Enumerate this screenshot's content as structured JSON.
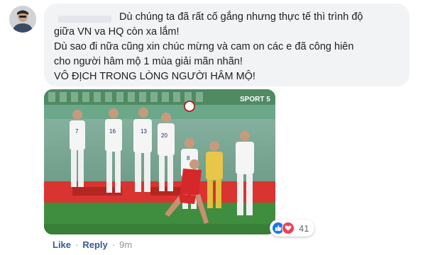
{
  "comment": {
    "lines": [
      "Dù chúng ta đã rất cố gắng nhưng thực tế thì trình độ",
      "giữa VN va HQ còn xa lắm!",
      "Dù sao đi nữa cũng xin chúc mừng và cam on các e đã công hiên",
      "cho người hâm mộ 1 mùa giải mãn nhãn!",
      "VÔ ĐỊCH TRONG LÒNG NGƯỜI HÂM MỘ!"
    ]
  },
  "photo": {
    "broadcaster_logo": "SPORT 5",
    "jersey_numbers": [
      "7",
      "16",
      "13",
      "20",
      "8"
    ]
  },
  "reactions": {
    "icons": [
      "like-icon",
      "love-icon"
    ],
    "count": "41",
    "like_color": "#1877f2",
    "love_color": "#f33e58"
  },
  "actions": {
    "like_label": "Like",
    "reply_label": "Reply",
    "separator": "·",
    "timestamp": "9m"
  }
}
